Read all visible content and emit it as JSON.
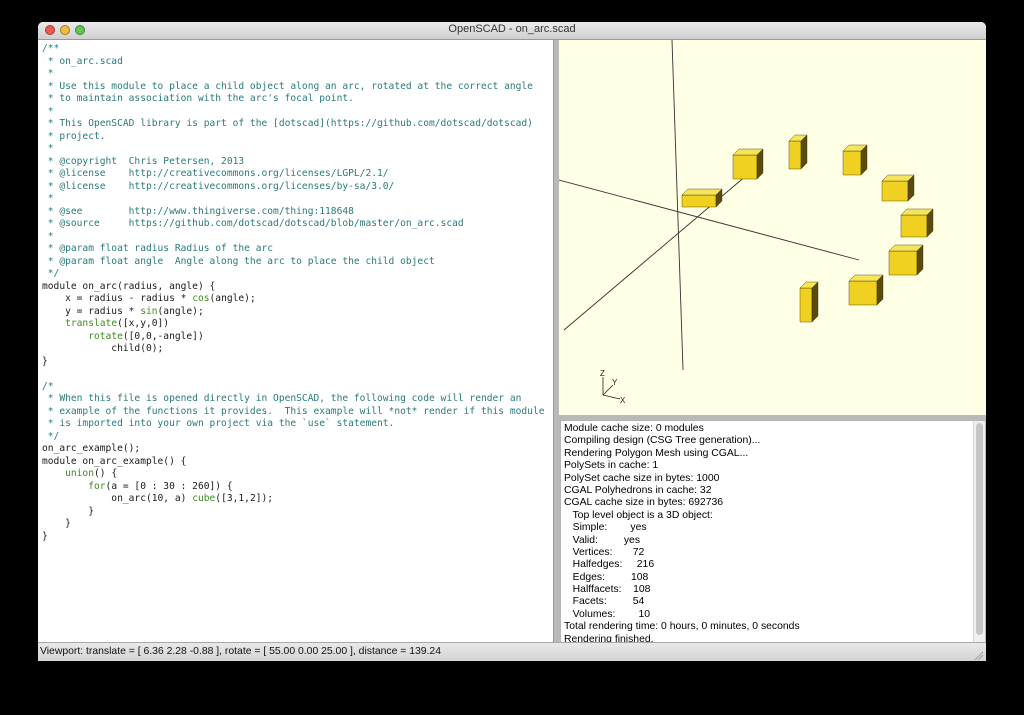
{
  "window": {
    "title": "OpenSCAD - on_arc.scad"
  },
  "editor": {
    "lines": [
      [
        {
          "t": "/**",
          "c": "cm"
        }
      ],
      [
        {
          "t": " * on_arc.scad",
          "c": "cm"
        }
      ],
      [
        {
          "t": " *",
          "c": "cm"
        }
      ],
      [
        {
          "t": " * Use this module to place a child object along an arc, rotated at the correct angle",
          "c": "cm"
        }
      ],
      [
        {
          "t": " * to maintain association with the arc's focal point.",
          "c": "cm"
        }
      ],
      [
        {
          "t": " *",
          "c": "cm"
        }
      ],
      [
        {
          "t": " * This OpenSCAD library is part of the [dotscad](https://github.com/dotscad/dotscad)",
          "c": "cm"
        }
      ],
      [
        {
          "t": " * project.",
          "c": "cm"
        }
      ],
      [
        {
          "t": " *",
          "c": "cm"
        }
      ],
      [
        {
          "t": " * @copyright  Chris Petersen, 2013",
          "c": "cm"
        }
      ],
      [
        {
          "t": " * @license    http://creativecommons.org/licenses/LGPL/2.1/",
          "c": "cm"
        }
      ],
      [
        {
          "t": " * @license    http://creativecommons.org/licenses/by-sa/3.0/",
          "c": "cm"
        }
      ],
      [
        {
          "t": " *",
          "c": "cm"
        }
      ],
      [
        {
          "t": " * @see        http://www.thingiverse.com/thing:118648",
          "c": "cm"
        }
      ],
      [
        {
          "t": " * @source     https://github.com/dotscad/dotscad/blob/master/on_arc.scad",
          "c": "cm"
        }
      ],
      [
        {
          "t": " *",
          "c": "cm"
        }
      ],
      [
        {
          "t": " * @param float radius Radius of the arc",
          "c": "cm"
        }
      ],
      [
        {
          "t": " * @param float angle  Angle along the arc to place the child object",
          "c": "cm"
        }
      ],
      [
        {
          "t": " */",
          "c": "cm"
        }
      ],
      [
        {
          "t": "module on_arc(radius, angle) {",
          "c": "kw"
        }
      ],
      [
        {
          "t": "    x = radius - radius * ",
          "c": "kw"
        },
        {
          "t": "cos",
          "c": "fn"
        },
        {
          "t": "(angle);",
          "c": "kw"
        }
      ],
      [
        {
          "t": "    y = radius * ",
          "c": "kw"
        },
        {
          "t": "sin",
          "c": "fn"
        },
        {
          "t": "(angle);",
          "c": "kw"
        }
      ],
      [
        {
          "t": "    ",
          "c": "kw"
        },
        {
          "t": "translate",
          "c": "fn"
        },
        {
          "t": "([x,y,0])",
          "c": "kw"
        }
      ],
      [
        {
          "t": "        ",
          "c": "kw"
        },
        {
          "t": "rotate",
          "c": "fn"
        },
        {
          "t": "([0,0,-angle])",
          "c": "kw"
        }
      ],
      [
        {
          "t": "            child(0);",
          "c": "kw"
        }
      ],
      [
        {
          "t": "}",
          "c": "kw"
        }
      ],
      [
        {
          "t": "",
          "c": "kw"
        }
      ],
      [
        {
          "t": "/*",
          "c": "cm"
        }
      ],
      [
        {
          "t": " * When this file is opened directly in OpenSCAD, the following code will render an",
          "c": "cm"
        }
      ],
      [
        {
          "t": " * example of the functions it provides.  This example will *not* render if this module",
          "c": "cm"
        }
      ],
      [
        {
          "t": " * is imported into your own project via the `use` statement.",
          "c": "cm"
        }
      ],
      [
        {
          "t": " */",
          "c": "cm"
        }
      ],
      [
        {
          "t": "on_arc_example();",
          "c": "kw"
        }
      ],
      [
        {
          "t": "module on_arc_example() {",
          "c": "kw"
        }
      ],
      [
        {
          "t": "    ",
          "c": "kw"
        },
        {
          "t": "union",
          "c": "fn"
        },
        {
          "t": "() {",
          "c": "kw"
        }
      ],
      [
        {
          "t": "        ",
          "c": "kw"
        },
        {
          "t": "for",
          "c": "fn"
        },
        {
          "t": "(a = [0 : 30 : 260]) {",
          "c": "kw"
        }
      ],
      [
        {
          "t": "            on_arc(10, a) ",
          "c": "kw"
        },
        {
          "t": "cube",
          "c": "fn"
        },
        {
          "t": "([3,1,2]);",
          "c": "kw"
        }
      ],
      [
        {
          "t": "        }",
          "c": "kw"
        }
      ],
      [
        {
          "t": "    }",
          "c": "kw"
        }
      ],
      [
        {
          "t": "}",
          "c": "kw"
        }
      ]
    ]
  },
  "viewer": {
    "background": "#ffffe6",
    "axis_labels": [
      "Z",
      "Y",
      "X"
    ],
    "object_color": "#f0d020"
  },
  "console": {
    "lines": [
      "Module cache size: 0 modules",
      "Compiling design (CSG Tree generation)...",
      "Rendering Polygon Mesh using CGAL...",
      "PolySets in cache: 1",
      "PolySet cache size in bytes: 1000",
      "CGAL Polyhedrons in cache: 32",
      "CGAL cache size in bytes: 692736",
      "   Top level object is a 3D object:",
      "   Simple:        yes",
      "   Valid:         yes",
      "   Vertices:       72",
      "   Halfedges:     216",
      "   Edges:         108",
      "   Halffacets:    108",
      "   Facets:         54",
      "   Volumes:        10",
      "Total rendering time: 0 hours, 0 minutes, 0 seconds",
      "Rendering finished."
    ]
  },
  "statusbar": {
    "text": "Viewport: translate = [ 6.36 2.28 -0.88 ], rotate = [ 55.00 0.00 25.00 ], distance = 139.24"
  }
}
